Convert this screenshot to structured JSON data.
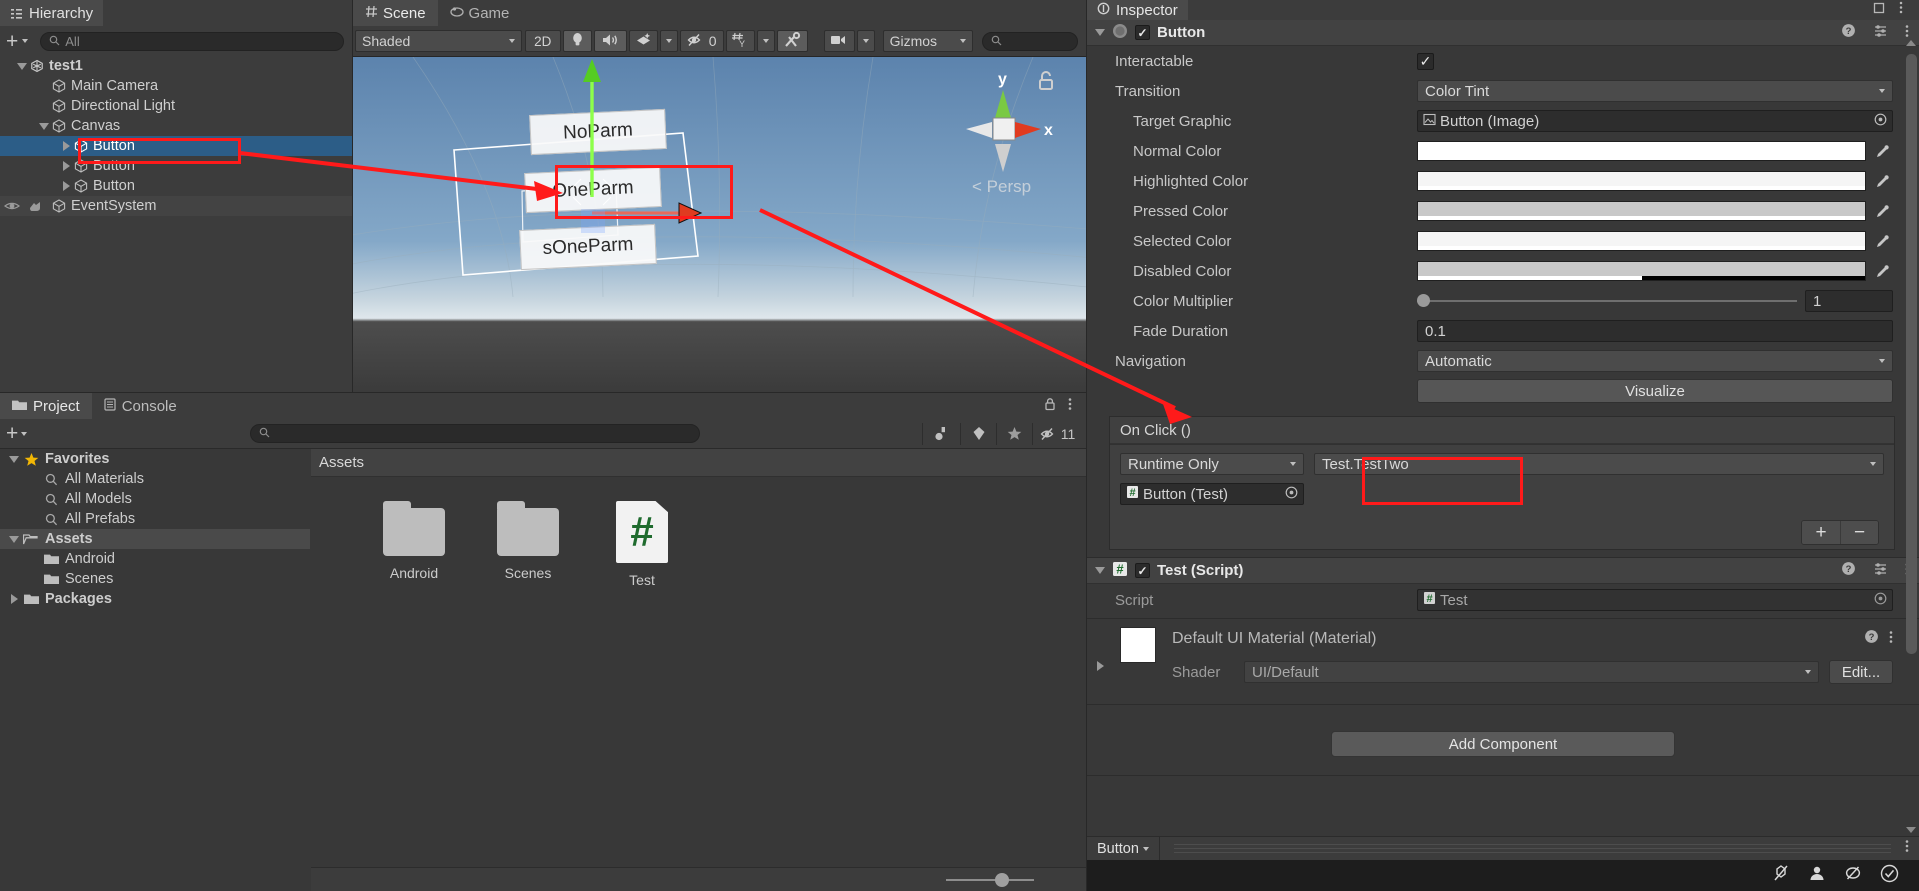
{
  "hierarchy": {
    "tab_label": "Hierarchy",
    "create_label": "+",
    "search_placeholder": "All",
    "items": [
      {
        "label": "test1",
        "depth": 0,
        "foldout": "down",
        "icon": "unity-scene-icon",
        "selected": false
      },
      {
        "label": "Main Camera",
        "depth": 1,
        "foldout": "none",
        "icon": "gameobject-cube-icon",
        "selected": false
      },
      {
        "label": "Directional Light",
        "depth": 1,
        "foldout": "none",
        "icon": "gameobject-cube-icon",
        "selected": false
      },
      {
        "label": "Canvas",
        "depth": 1,
        "foldout": "down",
        "icon": "gameobject-cube-icon",
        "selected": false
      },
      {
        "label": "Button",
        "depth": 2,
        "foldout": "right",
        "icon": "gameobject-cube-icon",
        "selected": true
      },
      {
        "label": "Button",
        "depth": 2,
        "foldout": "right",
        "icon": "gameobject-cube-icon",
        "selected": false
      },
      {
        "label": "Button",
        "depth": 2,
        "foldout": "right",
        "icon": "gameobject-cube-icon",
        "selected": false
      },
      {
        "label": "EventSystem",
        "depth": 1,
        "foldout": "none",
        "icon": "gameobject-cube-icon",
        "selected": false,
        "hovered": true
      }
    ]
  },
  "scene": {
    "tabs": [
      {
        "label": "Scene",
        "icon": "scene-grid-icon",
        "active": true
      },
      {
        "label": "Game",
        "icon": "game-display-icon",
        "active": false
      }
    ],
    "toolbar": {
      "draw_mode": "Shaded",
      "mode_2d": "2D",
      "lighting_icon": "lightbulb-icon",
      "audio_icon": "speaker-icon",
      "fx_icon": "effects-icon",
      "hidden_count": "0",
      "hidden_icon": "eye-off-icon",
      "grid_icon": "grid-axis-icon",
      "tools_icon": "tools-icon",
      "camera_icon": "scene-camera-icon",
      "gizmos_label": "Gizmos",
      "search_placeholder": ""
    },
    "gizmo": {
      "axis_y": "y",
      "axis_x": "x",
      "projection": "Persp",
      "back_chevron": "<",
      "lock_icon": "unlock-icon"
    },
    "ui_buttons": [
      {
        "label": "NoParm",
        "highlighted": false
      },
      {
        "label": "OneParm",
        "highlighted": true
      },
      {
        "label": "sOneParm",
        "highlighted": false
      }
    ]
  },
  "project": {
    "tabs": [
      {
        "label": "Project",
        "icon": "folder-icon",
        "active": true
      },
      {
        "label": "Console",
        "icon": "console-icon",
        "active": false
      }
    ],
    "create_label": "+",
    "search_placeholder": "",
    "toolbar_icons": [
      "asset-type-icon",
      "label-tag-icon",
      "favorite-star-icon"
    ],
    "hidden_packages_count": "11",
    "lock_icon": "lock-icon",
    "menu_icon": "kebab-menu-icon",
    "tree": [
      {
        "label": "Favorites",
        "depth": 0,
        "foldout": "down",
        "icon": "star-icon",
        "bold": true
      },
      {
        "label": "All Materials",
        "depth": 1,
        "foldout": "none",
        "icon": "search-icon",
        "bold": false
      },
      {
        "label": "All Models",
        "depth": 1,
        "foldout": "none",
        "icon": "search-icon",
        "bold": false
      },
      {
        "label": "All Prefabs",
        "depth": 1,
        "foldout": "none",
        "icon": "search-icon",
        "bold": false
      },
      {
        "label": "Assets",
        "depth": 0,
        "foldout": "down",
        "icon": "folder-open-icon",
        "bold": true,
        "selected": true
      },
      {
        "label": "Android",
        "depth": 1,
        "foldout": "none",
        "icon": "folder-icon",
        "bold": false
      },
      {
        "label": "Scenes",
        "depth": 1,
        "foldout": "none",
        "icon": "folder-icon",
        "bold": false
      },
      {
        "label": "Packages",
        "depth": 0,
        "foldout": "right",
        "icon": "folder-icon",
        "bold": true
      }
    ],
    "breadcrumb": "Assets",
    "assets": [
      {
        "label": "Android",
        "type": "folder"
      },
      {
        "label": "Scenes",
        "type": "folder"
      },
      {
        "label": "Test",
        "type": "csharp-script",
        "glyph": "#"
      }
    ]
  },
  "inspector": {
    "tab_label": "Inspector",
    "lock_icon": "lock-icon",
    "menu_icon": "kebab-menu-icon",
    "component_button": {
      "title": "Button",
      "enabled": true,
      "icon": "button-component-icon",
      "help_icon": "help-icon",
      "preset_icon": "preset-icon",
      "menu_icon": "kebab-menu-icon",
      "properties": [
        {
          "label": "Interactable",
          "type": "checkbox",
          "value": true,
          "indent": false
        },
        {
          "label": "Transition",
          "type": "dropdown",
          "value": "Color Tint",
          "indent": false
        },
        {
          "label": "Target Graphic",
          "type": "object",
          "value": "Button (Image)",
          "icon": "image-component-icon",
          "indent": true
        },
        {
          "label": "Normal Color",
          "type": "color",
          "value": "#ffffff",
          "alpha": 1.0,
          "indent": true
        },
        {
          "label": "Highlighted Color",
          "type": "color",
          "value": "#f5f5f5",
          "alpha": 1.0,
          "indent": true
        },
        {
          "label": "Pressed Color",
          "type": "color",
          "value": "#c8c8c8",
          "alpha": 1.0,
          "indent": true
        },
        {
          "label": "Selected Color",
          "type": "color",
          "value": "#f5f5f5",
          "alpha": 1.0,
          "indent": true
        },
        {
          "label": "Disabled Color",
          "type": "color",
          "value": "#c8c8c8",
          "alpha": 0.5,
          "indent": true
        },
        {
          "label": "Color Multiplier",
          "type": "slider",
          "value": "1",
          "indent": true
        },
        {
          "label": "Fade Duration",
          "type": "text",
          "value": "0.1",
          "indent": true
        },
        {
          "label": "Navigation",
          "type": "dropdown",
          "value": "Automatic",
          "indent": false
        }
      ],
      "visualize_label": "Visualize",
      "onclick": {
        "title": "On Click ()",
        "call_mode": "Runtime Only",
        "function": "Test.TestTwo",
        "target_object": "Button (Test)",
        "target_icon": "csharp-script-icon",
        "add_label": "+",
        "remove_label": "−"
      }
    },
    "component_script": {
      "title": "Test (Script)",
      "enabled": true,
      "icon": "csharp-script-icon",
      "help_icon": "help-icon",
      "preset_icon": "preset-icon",
      "menu_icon": "kebab-menu-icon",
      "script_label": "Script",
      "script_value": "Test"
    },
    "material": {
      "title": "Default UI Material (Material)",
      "shader_label": "Shader",
      "shader_value": "UI/Default",
      "edit_label": "Edit...",
      "help_icon": "help-icon",
      "menu_icon": "kebab-menu-icon"
    },
    "add_component_label": "Add Component",
    "footer_label": "Button",
    "statusbar_icons": [
      "no-collab-icon",
      "account-icon",
      "no-cloud-icon",
      "check-circle-icon"
    ]
  },
  "annotations": {
    "accent_color": "#ff1a1a",
    "boxes": [
      "hierarchy-button-row",
      "scene-oneparm-button",
      "onclick-function-field"
    ],
    "arrows": [
      "hierarchy-to-scene-arrow",
      "scene-to-onclick-arrow"
    ]
  }
}
